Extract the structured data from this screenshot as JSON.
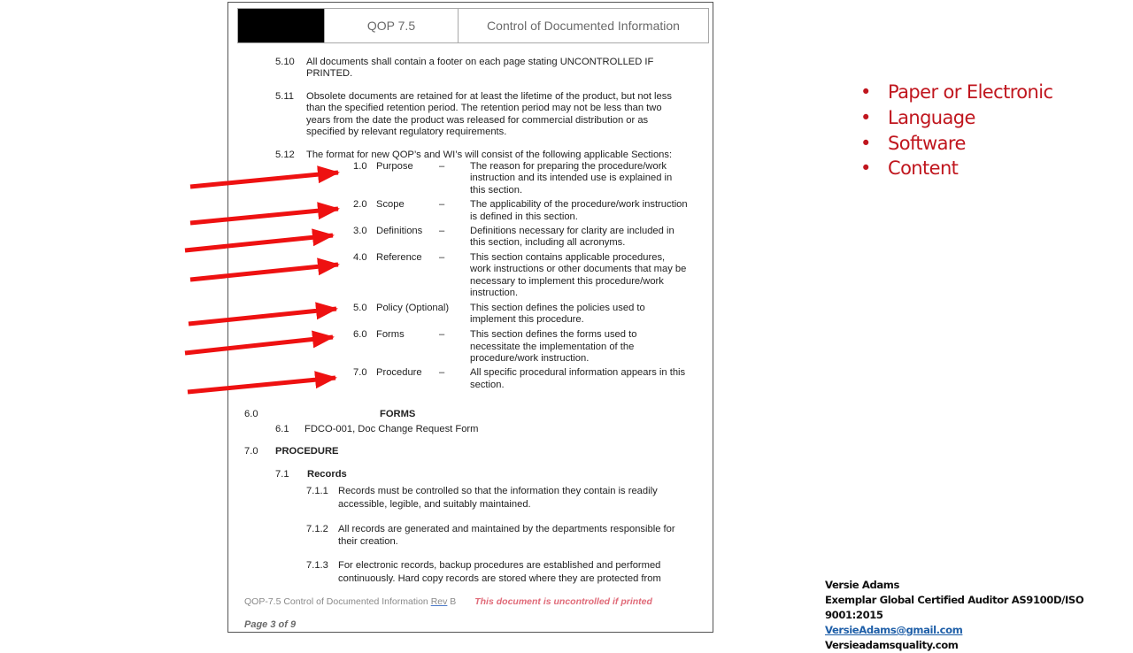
{
  "document": {
    "header": {
      "doc_number": "QOP 7.5",
      "doc_title": "Control of Documented Information"
    },
    "clauses": [
      {
        "num": "5.10",
        "lines": [
          "All documents shall contain a footer on each page stating UNCONTROLLED IF",
          "PRINTED."
        ]
      },
      {
        "num": "5.11",
        "lines": [
          "Obsolete documents are retained for at least the lifetime of the product, but not less",
          "than the specified retention period. The retention period may not be less than two",
          "years from the date the product was released for commercial distribution or as",
          "specified by relevant regulatory requirements."
        ]
      },
      {
        "num": "5.12",
        "lines": [
          "The format for new QOP’s and WI’s will consist of the following applicable Sections:"
        ]
      }
    ],
    "sections": [
      {
        "num": "1.0",
        "name": "Purpose",
        "dash": "–",
        "lines": [
          "The reason for preparing the procedure/work",
          "instruction and its intended use is explained in",
          "this section."
        ]
      },
      {
        "num": "2.0",
        "name": "Scope",
        "dash": "–",
        "lines": [
          "The applicability of the procedure/work instruction",
          "is defined in this section."
        ]
      },
      {
        "num": "3.0",
        "name": "Definitions",
        "dash": "–",
        "lines": [
          "Definitions necessary for clarity are included in",
          "this section, including all acronyms."
        ]
      },
      {
        "num": "4.0",
        "name": "Reference",
        "dash": "–",
        "lines": [
          "This section contains applicable procedures,",
          "work instructions or other documents that may be",
          "necessary to implement this procedure/work",
          "instruction."
        ]
      },
      {
        "num": "5.0",
        "name": "Policy (Optional)",
        "dash": "",
        "lines": [
          "This section defines the policies used to",
          "implement this procedure."
        ]
      },
      {
        "num": "6.0",
        "name": "Forms",
        "dash": "–",
        "lines": [
          "This section defines the forms used to",
          "necessitate the implementation of the",
          "procedure/work instruction."
        ]
      },
      {
        "num": "7.0",
        "name": "Procedure",
        "dash": "–",
        "lines": [
          "All specific procedural information appears in this",
          "section."
        ]
      }
    ],
    "forms": {
      "num": "6.0",
      "title": "FORMS",
      "items": [
        {
          "num": "6.1",
          "text": "FDCO-001, Doc Change Request Form"
        }
      ]
    },
    "procedure": {
      "num": "7.0",
      "title": "PROCEDURE",
      "sub": {
        "num": "7.1",
        "title": "Records"
      },
      "items": [
        {
          "num": "7.1.1",
          "lines": [
            "Records must be controlled so that the information they contain is readily",
            "accessible, legible, and suitably maintained."
          ]
        },
        {
          "num": "7.1.2",
          "lines": [
            "All records are generated and maintained by the departments responsible for",
            "their creation."
          ]
        },
        {
          "num": "7.1.3",
          "lines": [
            "For electronic records, backup procedures are established and performed",
            "continuously. Hard copy records are stored where they are protected from"
          ]
        }
      ]
    },
    "footer": {
      "doc_ref": "QOP-7.5 Control of Documented Information",
      "rev": "Rev",
      "rev_letter": "B",
      "warning": "This document is uncontrolled if printed",
      "page": "Page 3 of 9"
    }
  },
  "annotation": {
    "arrow_color": "#ee1111",
    "arrow_count": 7
  },
  "bullets": {
    "color": "#c0161e",
    "marker": "•",
    "items": [
      "Paper or Electronic",
      "Language",
      "Software",
      "Content"
    ]
  },
  "signature": {
    "name": "Versie Adams",
    "credential": "Exemplar Global Certified Auditor AS9100D/ISO 9001:2015",
    "email": "VersieAdams@gmail.com",
    "website": "Versieadamsquality.com"
  }
}
